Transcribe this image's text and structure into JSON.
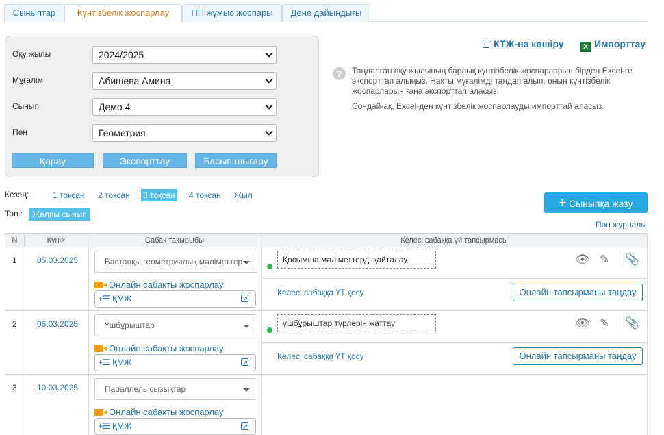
{
  "tabs": [
    "Сыныптар",
    "Күнтізбелік жоспарлау",
    "ПП жұмыс жоспары",
    "Дене дайындығы"
  ],
  "filters": {
    "year_label": "Оқу жылы",
    "year_value": "2024/2025",
    "teacher_label": "Мұғалім",
    "teacher_value": "Абишева Амина",
    "class_label": "Сынып",
    "class_value": "Демо 4",
    "subject_label": "Пән",
    "subject_value": "Геометрия"
  },
  "buttons": {
    "view": "Қарау",
    "export": "Экспорттау",
    "print": "Басып шығару"
  },
  "top_links": {
    "copy": "КТЖ-на көшіру",
    "import": "Импорттау"
  },
  "info": {
    "line1": "Таңдалған оқу жылының барлық күнтізбелік жоспарларын бірден Excel-ге экспорттап алыңыз. Нақты мұғалімді таңдап алып, оның күнтізбелік жоспарларын ғана экспорттап аласыз.",
    "line2": "Сондай-ақ, Excel-ден күнтізбелік жоспарлауды импорттай аласыз."
  },
  "period": {
    "label": "Кезең:",
    "items": [
      "1 тоқсан",
      "2 тоқсан",
      "3 тоқсан",
      "4 тоқсан",
      "Жыл"
    ],
    "active": "3 тоқсан"
  },
  "group": {
    "label": "Топ :",
    "value": "Жалпы сынып"
  },
  "write_button": "Сыныпқа жазу",
  "journal_link": "Пән журналы",
  "table": {
    "headers": [
      "N",
      "Күні>",
      "Сабақ тақырыбы",
      "Келесі сабаққа үй тапсырмасы"
    ],
    "online_label": "Онлайн сабақты жоспарлау",
    "kmzh_label": "+☰  ҚМЖ",
    "add_hw_label": "Келесі сабаққа ҮТ қосу",
    "choose_label": "Онлайн тапсырманы таңдау",
    "rows": [
      {
        "n": "1",
        "date": "05.03.2025",
        "topic": "Бастапқы геометриялық мәліметтер",
        "homework": "Қосымша мәліметтерді қайталау"
      },
      {
        "n": "2",
        "date": "06.03.2025",
        "topic": "Үшбұрыштар",
        "homework": "үшбұрыштар түрлерін жаттау"
      },
      {
        "n": "3",
        "date": "10.03.2025",
        "topic": "Параллель сызықтар",
        "homework": ""
      }
    ]
  },
  "colors": {
    "accent": "#2a7ab0",
    "active_tab": "#e07b1a",
    "badge": "#55c0e8",
    "button": "#26a9e0",
    "status_dot": "#2db84a"
  }
}
